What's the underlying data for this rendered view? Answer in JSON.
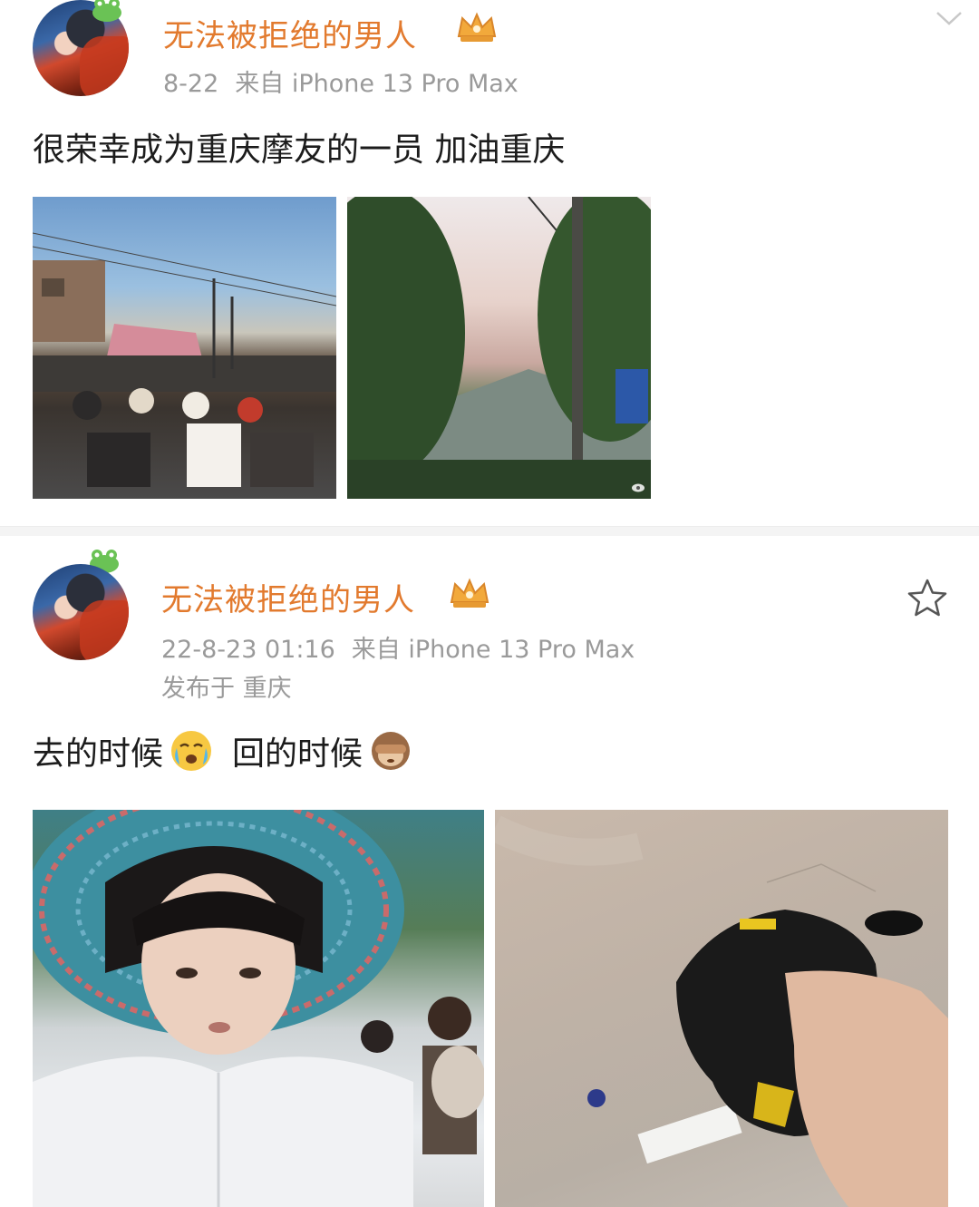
{
  "posts": [
    {
      "username": "无法被拒绝的男人",
      "date": "8-22",
      "source": "来自 iPhone 13 Pro Max",
      "text": "很荣幸成为重庆摩友的一员 加油重庆"
    },
    {
      "username": "无法被拒绝的男人",
      "date": "22-8-23 01:16",
      "source": "来自 iPhone 13 Pro Max",
      "location": "发布于 重庆",
      "text_part1": "去的时候",
      "text_part2": "回的时候"
    }
  ],
  "icons": {
    "collapse": "chevron-down-icon",
    "favorite": "star-outline-icon",
    "vip": "crown-badge-icon",
    "emoji1": "crying-face-emoji",
    "emoji2": "see-no-evil-monkey-emoji"
  },
  "colors": {
    "username": "#e27a2e",
    "meta": "#9a9a9a"
  }
}
